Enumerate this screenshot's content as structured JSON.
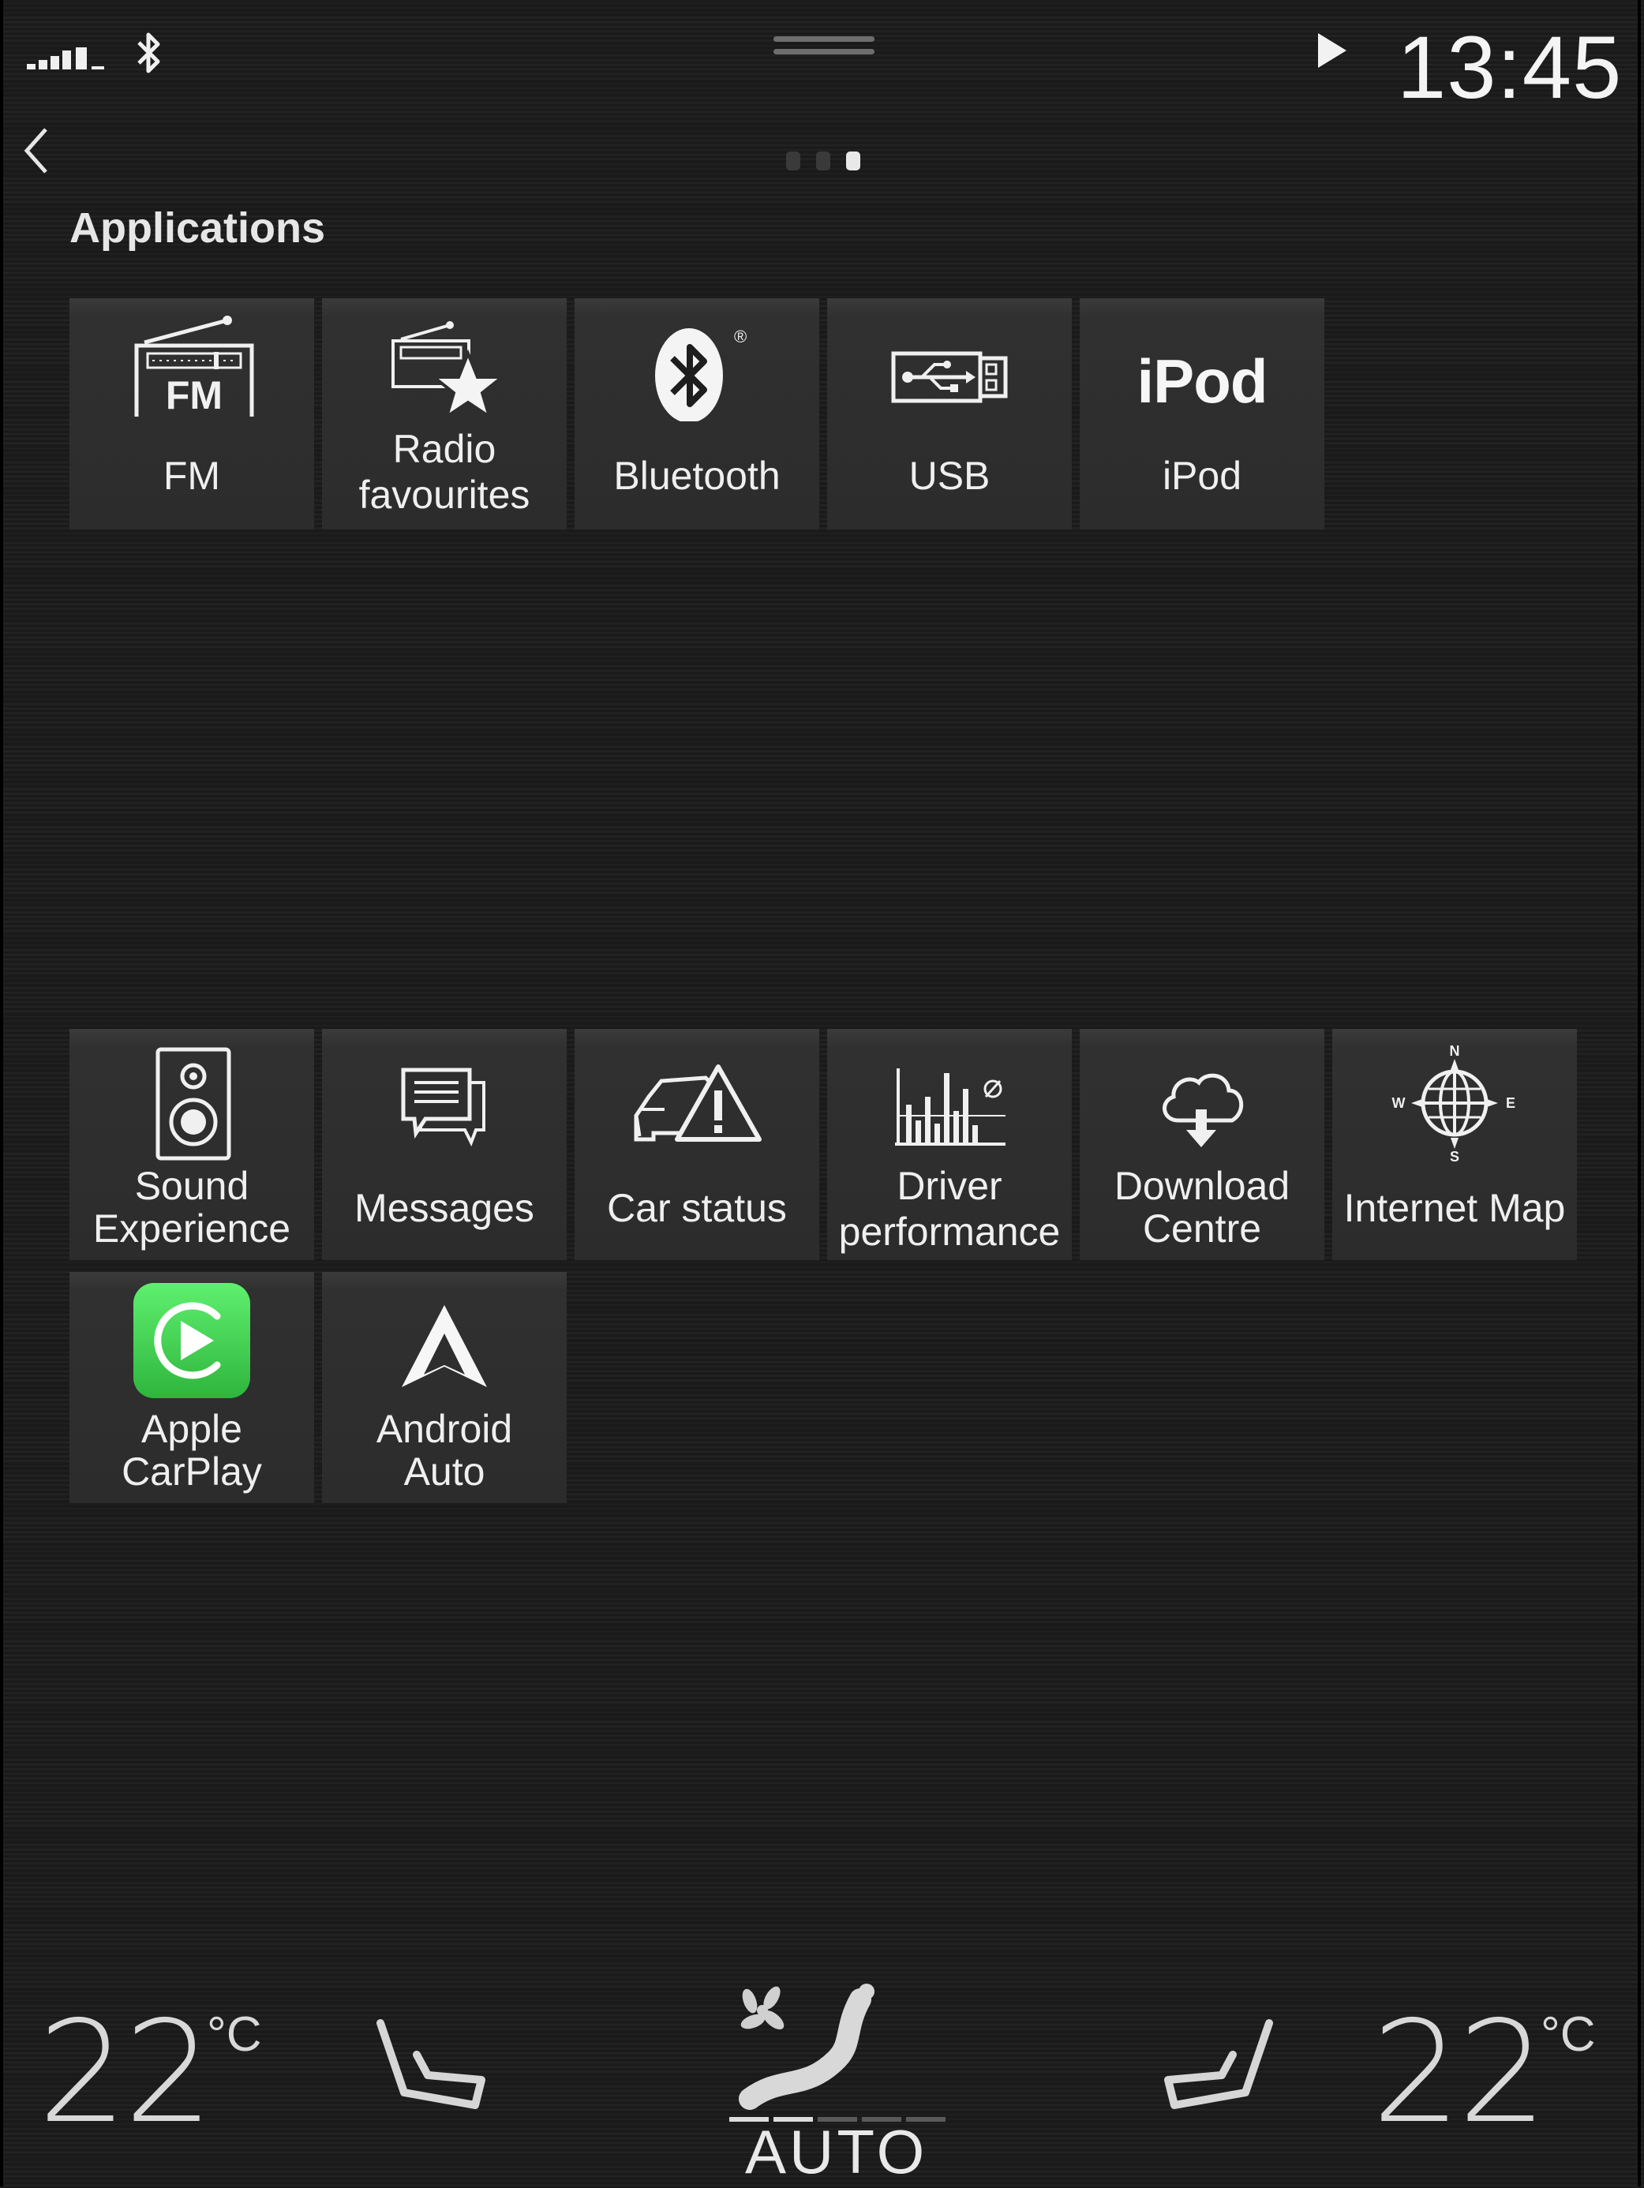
{
  "status_bar": {
    "signal_icon": "signal-strength-icon",
    "bluetooth_icon": "bluetooth-icon",
    "handle_icon": "pull-down-handle-icon",
    "play_icon": "play-icon",
    "time": "13:45"
  },
  "nav": {
    "back_icon": "back-chevron-icon",
    "page_indicator": {
      "pages": 3,
      "active": 3
    }
  },
  "section": {
    "title": "Applications"
  },
  "apps_row1": [
    {
      "id": "fm",
      "label_line1": "FM",
      "label_line2": "",
      "icon": "fm-radio-icon",
      "icon_text": "FM"
    },
    {
      "id": "radio-favourites",
      "label_line1": "Radio",
      "label_line2": "favourites",
      "icon": "radio-star-icon",
      "icon_text": ""
    },
    {
      "id": "bluetooth",
      "label_line1": "Bluetooth",
      "label_line2": "",
      "icon": "bluetooth-logo-icon",
      "icon_text": "®"
    },
    {
      "id": "usb",
      "label_line1": "USB",
      "label_line2": "",
      "icon": "usb-icon",
      "icon_text": ""
    },
    {
      "id": "ipod",
      "label_line1": "iPod",
      "label_line2": "",
      "icon": "ipod-wordmark-icon",
      "icon_text": "iPod"
    }
  ],
  "apps_row2": [
    {
      "id": "sound-experience",
      "label_line1": "Sound",
      "label_line2": "Experience",
      "icon": "speaker-icon"
    },
    {
      "id": "messages",
      "label_line1": "Messages",
      "label_line2": "",
      "icon": "messages-icon"
    },
    {
      "id": "car-status",
      "label_line1": "Car status",
      "label_line2": "",
      "icon": "car-warning-icon"
    },
    {
      "id": "driver-performance",
      "label_line1": "Driver",
      "label_line2": "performance",
      "icon": "bar-graph-icon"
    },
    {
      "id": "download-centre",
      "label_line1": "Download",
      "label_line2": "Centre",
      "icon": "cloud-download-icon"
    },
    {
      "id": "internet-map",
      "label_line1": "Internet Map",
      "label_line2": "",
      "icon": "globe-compass-icon",
      "compass": {
        "n": "N",
        "e": "E",
        "s": "S",
        "w": "W"
      }
    }
  ],
  "apps_row3": [
    {
      "id": "apple-carplay",
      "label_line1": "Apple",
      "label_line2": "CarPlay",
      "icon": "carplay-icon"
    },
    {
      "id": "android-auto",
      "label_line1": "Android",
      "label_line2": "Auto",
      "icon": "android-auto-icon"
    }
  ],
  "climate": {
    "left_temp": "22",
    "left_unit": "°C",
    "left_seat_icon": "left-seat-heater-icon",
    "fan_icon": "fan-airflow-icon",
    "fan_mode": "AUTO",
    "fan_levels": 5,
    "fan_level_active": 2,
    "right_seat_icon": "right-seat-heater-icon",
    "right_temp": "22",
    "right_unit": "°C"
  },
  "colors": {
    "background": "#1e1e1e",
    "tile": "#2e2e2e",
    "text": "#efefef",
    "carplay_green": "#4cd964"
  }
}
